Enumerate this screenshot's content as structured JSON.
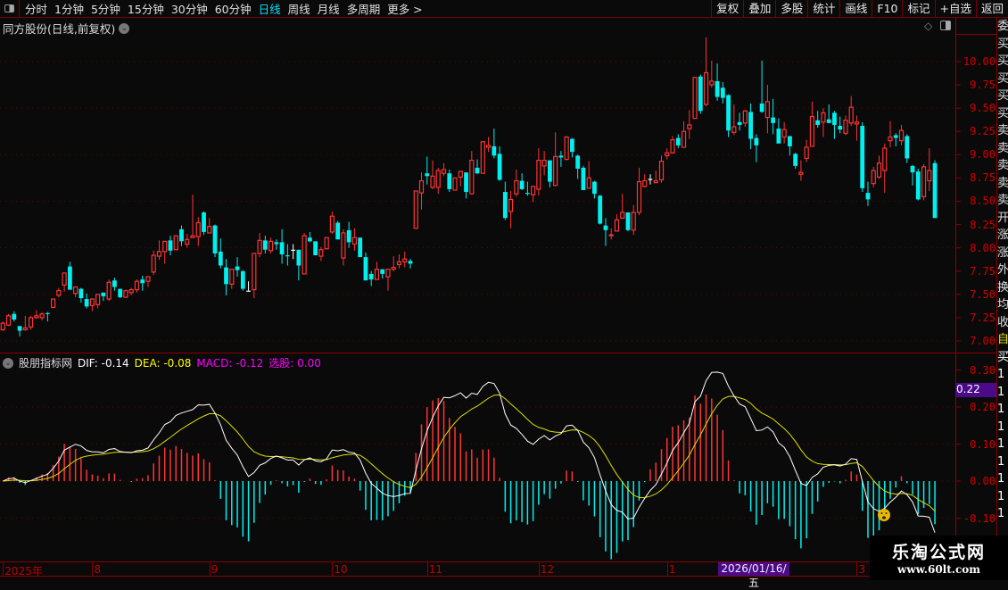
{
  "topbar": {
    "periods": [
      "分时",
      "1分钟",
      "5分钟",
      "15分钟",
      "30分钟",
      "60分钟",
      "日线",
      "周线",
      "月线",
      "多周期",
      "更多 >"
    ],
    "active": "日线",
    "buttons": [
      "复权",
      "叠加",
      "多股",
      "统计",
      "画线",
      "F10",
      "标记",
      "+自选",
      "返回"
    ]
  },
  "title": "同方股份(日线,前复权)",
  "price_axis": [
    "10.00",
    "9.75",
    "9.50",
    "9.25",
    "9.00",
    "8.75",
    "8.50",
    "8.25",
    "8.00",
    "7.75",
    "7.50",
    "7.25",
    "7.00"
  ],
  "indicator": {
    "name": "股朋指标网",
    "dif": "DIF: -0.14",
    "dea": "DEA: -0.08",
    "macd": "MACD: -0.12",
    "pick": "选股: 0.00"
  },
  "macd_axis": [
    "0.30",
    "0.20",
    "0.10",
    "0.00",
    "-0.10"
  ],
  "macd_marker": "0.22",
  "dates": {
    "labels": [
      {
        "t": "2025年",
        "i": 0
      },
      {
        "t": "8",
        "i": 16
      },
      {
        "t": "9",
        "i": 37
      },
      {
        "t": "10",
        "i": 59
      },
      {
        "t": "11",
        "i": 76
      },
      {
        "t": "12",
        "i": 96
      },
      {
        "t": "1",
        "i": 119
      },
      {
        "t": "3",
        "i": 153
      }
    ],
    "selected": "2026/01/16/五"
  },
  "side_column": [
    "委",
    "买",
    "买",
    "买",
    "买",
    "买",
    "卖",
    "卖",
    "卖",
    "卖",
    "卖",
    "开",
    "涨",
    "涨",
    "外",
    "换",
    "均",
    "收",
    "",
    "自",
    "买",
    "1",
    "1",
    "1",
    "1",
    "1",
    "1",
    "1",
    "1",
    "1"
  ],
  "watermark": {
    "name": "乐淘公式网",
    "url": "www.60lt.com"
  },
  "colors": {
    "up": "#ff3333",
    "down": "#00f0f0",
    "flat": "#ffffff",
    "dif": "#ffffff",
    "dea": "#e0e000",
    "macd": "#ff00ff"
  },
  "chart_data": {
    "type": "candlestick",
    "ohlc": [
      [
        7.12,
        7.21,
        7.11,
        7.19
      ],
      [
        7.17,
        7.29,
        7.16,
        7.27
      ],
      [
        7.29,
        7.32,
        7.21,
        7.23
      ],
      [
        7.16,
        7.16,
        7.05,
        7.11
      ],
      [
        7.12,
        7.27,
        7.11,
        7.14
      ],
      [
        7.15,
        7.27,
        7.12,
        7.25
      ],
      [
        7.25,
        7.33,
        7.24,
        7.27
      ],
      [
        7.25,
        7.31,
        7.22,
        7.29
      ],
      [
        7.3,
        7.31,
        7.21,
        7.29
      ],
      [
        7.36,
        7.45,
        7.36,
        7.45
      ],
      [
        7.49,
        7.57,
        7.47,
        7.54
      ],
      [
        7.6,
        7.73,
        7.53,
        7.73
      ],
      [
        7.8,
        7.85,
        7.55,
        7.55
      ],
      [
        7.51,
        7.58,
        7.47,
        7.58
      ],
      [
        7.56,
        7.57,
        7.41,
        7.46
      ],
      [
        7.45,
        7.51,
        7.35,
        7.37
      ],
      [
        7.38,
        7.46,
        7.32,
        7.45
      ],
      [
        7.39,
        7.5,
        7.35,
        7.5
      ],
      [
        7.52,
        7.52,
        7.43,
        7.48
      ],
      [
        7.45,
        7.66,
        7.43,
        7.63
      ],
      [
        7.65,
        7.68,
        7.54,
        7.58
      ],
      [
        7.56,
        7.56,
        7.46,
        7.47
      ],
      [
        7.47,
        7.55,
        7.46,
        7.54
      ],
      [
        7.52,
        7.57,
        7.49,
        7.55
      ],
      [
        7.55,
        7.66,
        7.52,
        7.64
      ],
      [
        7.66,
        7.7,
        7.54,
        7.62
      ],
      [
        7.64,
        7.69,
        7.58,
        7.69
      ],
      [
        7.74,
        7.97,
        7.71,
        7.92
      ],
      [
        7.91,
        8.08,
        7.87,
        7.96
      ],
      [
        7.96,
        8.07,
        7.83,
        8.07
      ],
      [
        8.08,
        8.13,
        7.92,
        7.97
      ],
      [
        7.98,
        8.13,
        7.98,
        8.13
      ],
      [
        8.2,
        8.24,
        8.02,
        8.07
      ],
      [
        8.04,
        8.15,
        8.0,
        8.09
      ],
      [
        8.11,
        8.57,
        8.11,
        8.13
      ],
      [
        8.12,
        8.33,
        8.02,
        8.27
      ],
      [
        8.38,
        8.39,
        8.14,
        8.17
      ],
      [
        8.16,
        8.32,
        8.16,
        8.23
      ],
      [
        8.24,
        8.25,
        7.9,
        7.94
      ],
      [
        7.96,
        8.1,
        7.78,
        7.81
      ],
      [
        7.79,
        7.88,
        7.49,
        7.61
      ],
      [
        7.61,
        7.77,
        7.56,
        7.77
      ],
      [
        7.8,
        7.9,
        7.69,
        7.76
      ],
      [
        7.75,
        7.76,
        7.54,
        7.56
      ],
      [
        7.54,
        7.64,
        7.54,
        7.54
      ],
      [
        7.55,
        7.94,
        7.46,
        7.94
      ],
      [
        7.94,
        8.16,
        7.9,
        8.08
      ],
      [
        8.08,
        8.13,
        7.94,
        7.98
      ],
      [
        7.97,
        8.11,
        7.94,
        8.07
      ],
      [
        8.06,
        8.09,
        7.98,
        8.04
      ],
      [
        8.06,
        8.2,
        7.83,
        7.93
      ],
      [
        7.92,
        8.04,
        7.81,
        7.91
      ],
      [
        7.98,
        8.04,
        7.88,
        7.98
      ],
      [
        7.98,
        7.98,
        7.65,
        7.81
      ],
      [
        7.72,
        8.16,
        7.72,
        8.13
      ],
      [
        8.11,
        8.17,
        8.06,
        8.07
      ],
      [
        8.07,
        8.07,
        7.92,
        7.92
      ],
      [
        7.91,
        8.01,
        7.86,
        7.98
      ],
      [
        7.99,
        8.11,
        7.99,
        8.11
      ],
      [
        8.17,
        8.39,
        8.15,
        8.34
      ],
      [
        8.27,
        8.29,
        8.09,
        8.09
      ],
      [
        7.89,
        8.2,
        7.81,
        8.16
      ],
      [
        8.19,
        8.28,
        8.0,
        8.06
      ],
      [
        8.04,
        8.21,
        7.97,
        8.11
      ],
      [
        8.11,
        8.11,
        7.9,
        7.9
      ],
      [
        7.9,
        7.95,
        7.65,
        7.65
      ],
      [
        7.72,
        7.75,
        7.59,
        7.66
      ],
      [
        7.66,
        7.85,
        7.66,
        7.77
      ],
      [
        7.77,
        7.77,
        7.67,
        7.72
      ],
      [
        7.69,
        7.77,
        7.54,
        7.77
      ],
      [
        7.77,
        7.91,
        7.75,
        7.79
      ],
      [
        7.82,
        7.93,
        7.78,
        7.85
      ],
      [
        7.85,
        7.96,
        7.79,
        7.88
      ],
      [
        7.86,
        7.88,
        7.78,
        7.83
      ],
      [
        8.21,
        8.61,
        8.21,
        8.61
      ],
      [
        8.59,
        8.81,
        8.41,
        8.72
      ],
      [
        8.8,
        8.98,
        8.68,
        8.77
      ],
      [
        8.65,
        8.94,
        8.63,
        8.77
      ],
      [
        8.65,
        8.86,
        8.58,
        8.83
      ],
      [
        8.8,
        8.91,
        8.77,
        8.84
      ],
      [
        8.8,
        8.84,
        8.6,
        8.63
      ],
      [
        8.62,
        8.75,
        8.62,
        8.75
      ],
      [
        8.76,
        8.83,
        8.66,
        8.82
      ],
      [
        8.81,
        8.81,
        8.53,
        8.6
      ],
      [
        8.58,
        9.04,
        8.58,
        8.94
      ],
      [
        8.86,
        8.95,
        8.79,
        8.8
      ],
      [
        8.8,
        9.14,
        8.8,
        9.14
      ],
      [
        9.08,
        9.19,
        9.03,
        9.1
      ],
      [
        9.09,
        9.28,
        8.96,
        8.99
      ],
      [
        9.01,
        9.09,
        8.72,
        8.73
      ],
      [
        8.6,
        8.71,
        8.3,
        8.32
      ],
      [
        8.39,
        8.61,
        8.21,
        8.52
      ],
      [
        8.58,
        8.84,
        8.55,
        8.72
      ],
      [
        8.72,
        8.8,
        8.62,
        8.63
      ],
      [
        8.59,
        8.71,
        8.56,
        8.58
      ],
      [
        8.57,
        8.66,
        8.49,
        8.66
      ],
      [
        8.63,
        9.07,
        8.56,
        8.94
      ],
      [
        8.88,
        9.04,
        8.78,
        8.94
      ],
      [
        8.94,
        8.94,
        8.65,
        8.71
      ],
      [
        8.67,
        9.24,
        8.67,
        8.98
      ],
      [
        8.99,
        9.04,
        8.87,
        8.97
      ],
      [
        8.95,
        9.2,
        8.94,
        9.19
      ],
      [
        9.17,
        9.18,
        8.97,
        9.03
      ],
      [
        8.99,
        9.0,
        8.74,
        8.85
      ],
      [
        8.86,
        8.88,
        8.62,
        8.62
      ],
      [
        8.64,
        8.93,
        8.64,
        8.75
      ],
      [
        8.71,
        8.72,
        8.53,
        8.58
      ],
      [
        8.56,
        8.57,
        8.25,
        8.26
      ],
      [
        8.24,
        8.32,
        8.02,
        8.19
      ],
      [
        8.13,
        8.21,
        8.09,
        8.14
      ],
      [
        8.18,
        8.36,
        8.18,
        8.3
      ],
      [
        8.32,
        8.58,
        8.31,
        8.38
      ],
      [
        8.38,
        8.38,
        8.18,
        8.19
      ],
      [
        8.19,
        8.46,
        8.14,
        8.38
      ],
      [
        8.38,
        8.86,
        8.35,
        8.71
      ],
      [
        8.66,
        8.79,
        8.65,
        8.72
      ],
      [
        8.74,
        8.79,
        8.68,
        8.74
      ],
      [
        8.7,
        8.83,
        8.7,
        8.72
      ],
      [
        8.73,
        8.99,
        8.7,
        8.93
      ],
      [
        8.99,
        9.07,
        8.95,
        9.02
      ],
      [
        9.02,
        9.2,
        9.01,
        9.16
      ],
      [
        9.18,
        9.22,
        9.07,
        9.1
      ],
      [
        9.08,
        9.36,
        9.08,
        9.25
      ],
      [
        9.28,
        9.48,
        9.17,
        9.32
      ],
      [
        9.39,
        9.83,
        9.39,
        9.83
      ],
      [
        9.84,
        9.86,
        9.44,
        9.47
      ],
      [
        9.54,
        10.26,
        9.52,
        9.88
      ],
      [
        9.75,
        10.01,
        9.72,
        9.79
      ],
      [
        9.79,
        9.98,
        9.58,
        9.62
      ],
      [
        9.72,
        9.78,
        9.55,
        9.61
      ],
      [
        9.64,
        9.65,
        9.19,
        9.26
      ],
      [
        9.24,
        9.54,
        9.21,
        9.3
      ],
      [
        9.35,
        9.45,
        9.26,
        9.32
      ],
      [
        9.34,
        9.48,
        9.3,
        9.47
      ],
      [
        9.46,
        9.55,
        9.06,
        9.17
      ],
      [
        9.18,
        9.22,
        8.92,
        9.1
      ],
      [
        9.55,
        10.01,
        9.45,
        9.46
      ],
      [
        9.4,
        9.75,
        9.23,
        9.57
      ],
      [
        9.4,
        9.6,
        9.22,
        9.34
      ],
      [
        9.28,
        9.39,
        9.12,
        9.12
      ],
      [
        9.19,
        9.35,
        9.12,
        9.27
      ],
      [
        9.2,
        9.2,
        8.99,
        9.09
      ],
      [
        9.01,
        9.02,
        8.85,
        8.88
      ],
      [
        8.79,
        8.94,
        8.72,
        8.81
      ],
      [
        8.96,
        9.16,
        8.92,
        9.08
      ],
      [
        9.09,
        9.57,
        9.09,
        9.41
      ],
      [
        9.37,
        9.47,
        9.29,
        9.32
      ],
      [
        9.35,
        9.5,
        9.19,
        9.45
      ],
      [
        9.38,
        9.54,
        9.34,
        9.34
      ],
      [
        9.45,
        9.47,
        9.17,
        9.32
      ],
      [
        9.31,
        9.41,
        9.23,
        9.27
      ],
      [
        9.23,
        9.42,
        9.21,
        9.37
      ],
      [
        9.34,
        9.63,
        9.31,
        9.51
      ],
      [
        9.33,
        9.42,
        9.15,
        9.35
      ],
      [
        9.31,
        9.35,
        8.6,
        8.64
      ],
      [
        8.59,
        8.71,
        8.45,
        8.52
      ],
      [
        8.69,
        8.87,
        8.65,
        8.83
      ],
      [
        8.76,
        8.99,
        8.74,
        8.91
      ],
      [
        8.83,
        9.12,
        8.59,
        9.07
      ],
      [
        9.15,
        9.36,
        9.08,
        9.19
      ],
      [
        9.21,
        9.23,
        9.09,
        9.18
      ],
      [
        9.15,
        9.32,
        9.1,
        9.26
      ],
      [
        9.2,
        9.22,
        8.91,
        8.96
      ],
      [
        8.88,
        8.89,
        8.67,
        8.81
      ],
      [
        8.82,
        8.85,
        8.51,
        8.52
      ],
      [
        8.55,
        8.9,
        8.51,
        8.87
      ],
      [
        8.72,
        9.07,
        8.61,
        8.83
      ],
      [
        8.91,
        8.94,
        8.32,
        8.32
      ]
    ],
    "price_range": [
      7.0,
      10.0
    ],
    "indicator": "MACD(12,26,9)",
    "macd_range": [
      -0.15,
      0.3
    ]
  }
}
